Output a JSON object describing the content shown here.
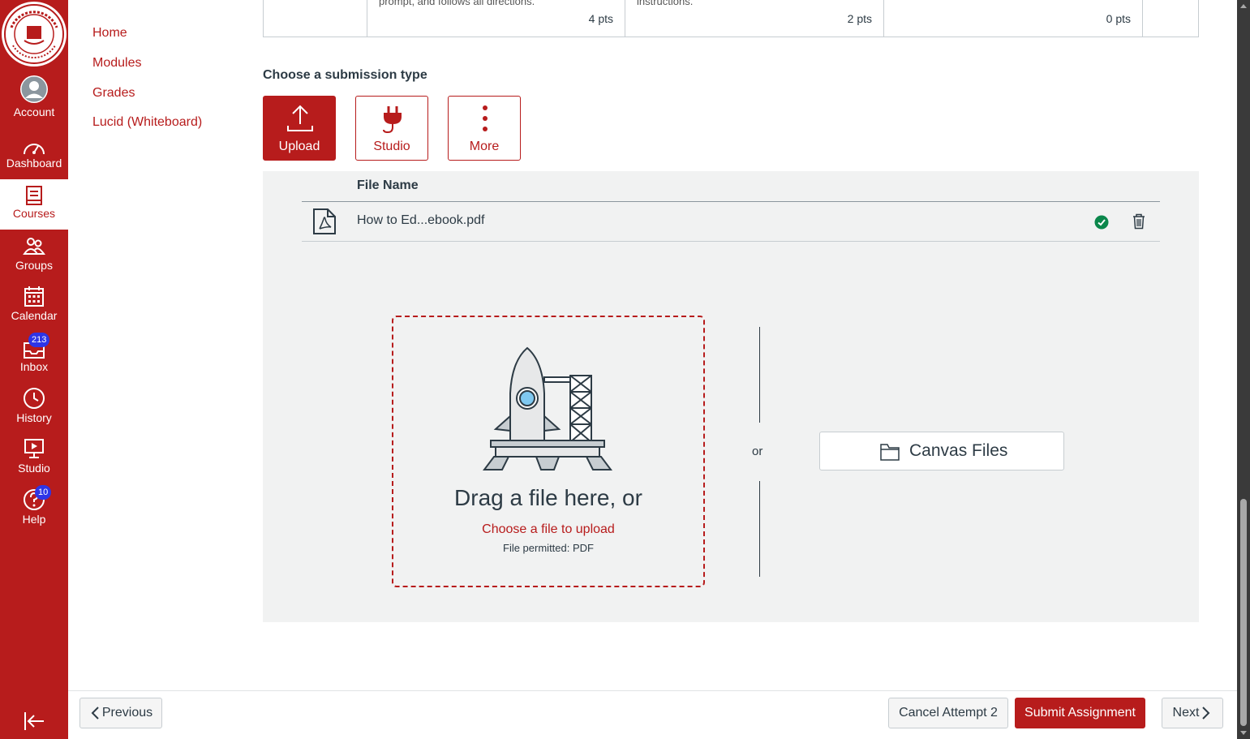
{
  "global_nav": {
    "items": [
      {
        "label": "Account",
        "icon": "account-icon"
      },
      {
        "label": "Dashboard",
        "icon": "dashboard-icon"
      },
      {
        "label": "Courses",
        "icon": "courses-icon"
      },
      {
        "label": "Groups",
        "icon": "groups-icon"
      },
      {
        "label": "Calendar",
        "icon": "calendar-icon"
      },
      {
        "label": "Inbox",
        "icon": "inbox-icon",
        "badge": "213"
      },
      {
        "label": "History",
        "icon": "history-icon"
      },
      {
        "label": "Studio",
        "icon": "studio-icon"
      },
      {
        "label": "Help",
        "icon": "help-icon",
        "badge": "10"
      }
    ],
    "brand_color": "#b71c1c"
  },
  "course_nav": {
    "items": [
      {
        "label": "Home"
      },
      {
        "label": "Modules"
      },
      {
        "label": "Grades"
      },
      {
        "label": "Lucid (Whiteboard)"
      }
    ]
  },
  "rubric": {
    "cells": [
      {
        "text": "prompt, and follows all directions.",
        "pts": "4 pts"
      },
      {
        "text": "instructions.",
        "pts": "2 pts"
      },
      {
        "text": "",
        "pts": "0 pts"
      }
    ]
  },
  "submission": {
    "title": "Choose a submission type",
    "types": [
      {
        "label": "Upload",
        "icon": "upload-icon",
        "selected": true
      },
      {
        "label": "Studio",
        "icon": "plug-icon",
        "selected": false
      },
      {
        "label": "More",
        "icon": "more-vertical-icon",
        "selected": false
      }
    ],
    "file_table": {
      "header": "File Name",
      "files": [
        {
          "name": "How to Ed...ebook.pdf",
          "icon": "pdf-file-icon",
          "status": "uploaded"
        }
      ]
    },
    "dropzone": {
      "title": "Drag a file here, or",
      "link": "Choose a file to upload",
      "note": "File permitted: PDF"
    },
    "or_text": "or",
    "canvas_files_label": "Canvas Files"
  },
  "footer": {
    "previous_label": "Previous",
    "cancel_label": "Cancel Attempt 2",
    "submit_label": "Submit Assignment",
    "next_label": "Next"
  }
}
